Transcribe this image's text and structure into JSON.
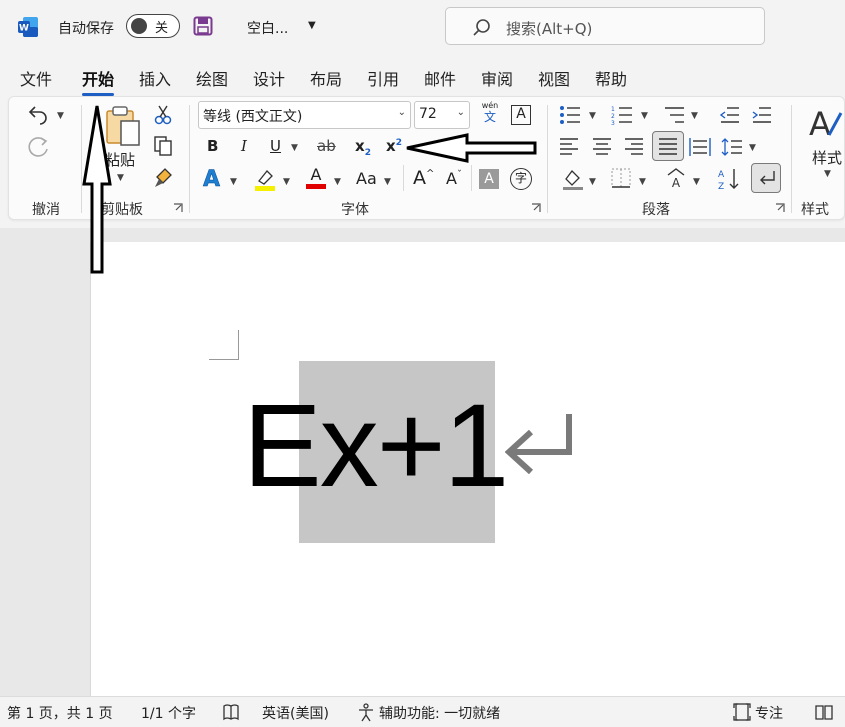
{
  "titlebar": {
    "autosave_label": "自动保存",
    "autosave_state": "关",
    "doc_title": "空白...",
    "search_placeholder": "搜索(Alt+Q)"
  },
  "tabs": [
    {
      "label": "文件"
    },
    {
      "label": "开始",
      "active": true
    },
    {
      "label": "插入"
    },
    {
      "label": "绘图"
    },
    {
      "label": "设计"
    },
    {
      "label": "布局"
    },
    {
      "label": "引用"
    },
    {
      "label": "邮件"
    },
    {
      "label": "审阅"
    },
    {
      "label": "视图"
    },
    {
      "label": "帮助"
    }
  ],
  "ribbon": {
    "groups": {
      "undo": "撤消",
      "clipboard": "剪贴板",
      "font": "字体",
      "paragraph": "段落",
      "styles": "样式"
    },
    "paste_label": "粘贴",
    "styles_button": "样式",
    "font_name": "等线 (西文正文)",
    "font_size": "72",
    "phonetic_top": "wén",
    "phonetic_bottom": "文",
    "bold": "B",
    "italic": "I",
    "underline": "U",
    "strike": "ab",
    "subscript": "x",
    "subscript_mark": "2",
    "superscript": "x",
    "superscript_mark": "2",
    "change_case": "Aa",
    "grow_font": "A",
    "shrink_font": "A",
    "char_shading": "A",
    "enclose_char": "字",
    "text_effects": "A",
    "font_color": "A",
    "highlight_color": "#f4f000",
    "font_color_value": "#e00000"
  },
  "document": {
    "text_before": "E",
    "text_selected": "x+1"
  },
  "statusbar": {
    "page": "第 1 页，共 1 页",
    "words": "1/1 个字",
    "language": "英语(美国)",
    "accessibility": "辅助功能: 一切就绪",
    "focus": "专注"
  },
  "colors": {
    "accent": "#1e5fc4",
    "word_blue": "#185abd",
    "save_purple": "#7a3a8f"
  }
}
